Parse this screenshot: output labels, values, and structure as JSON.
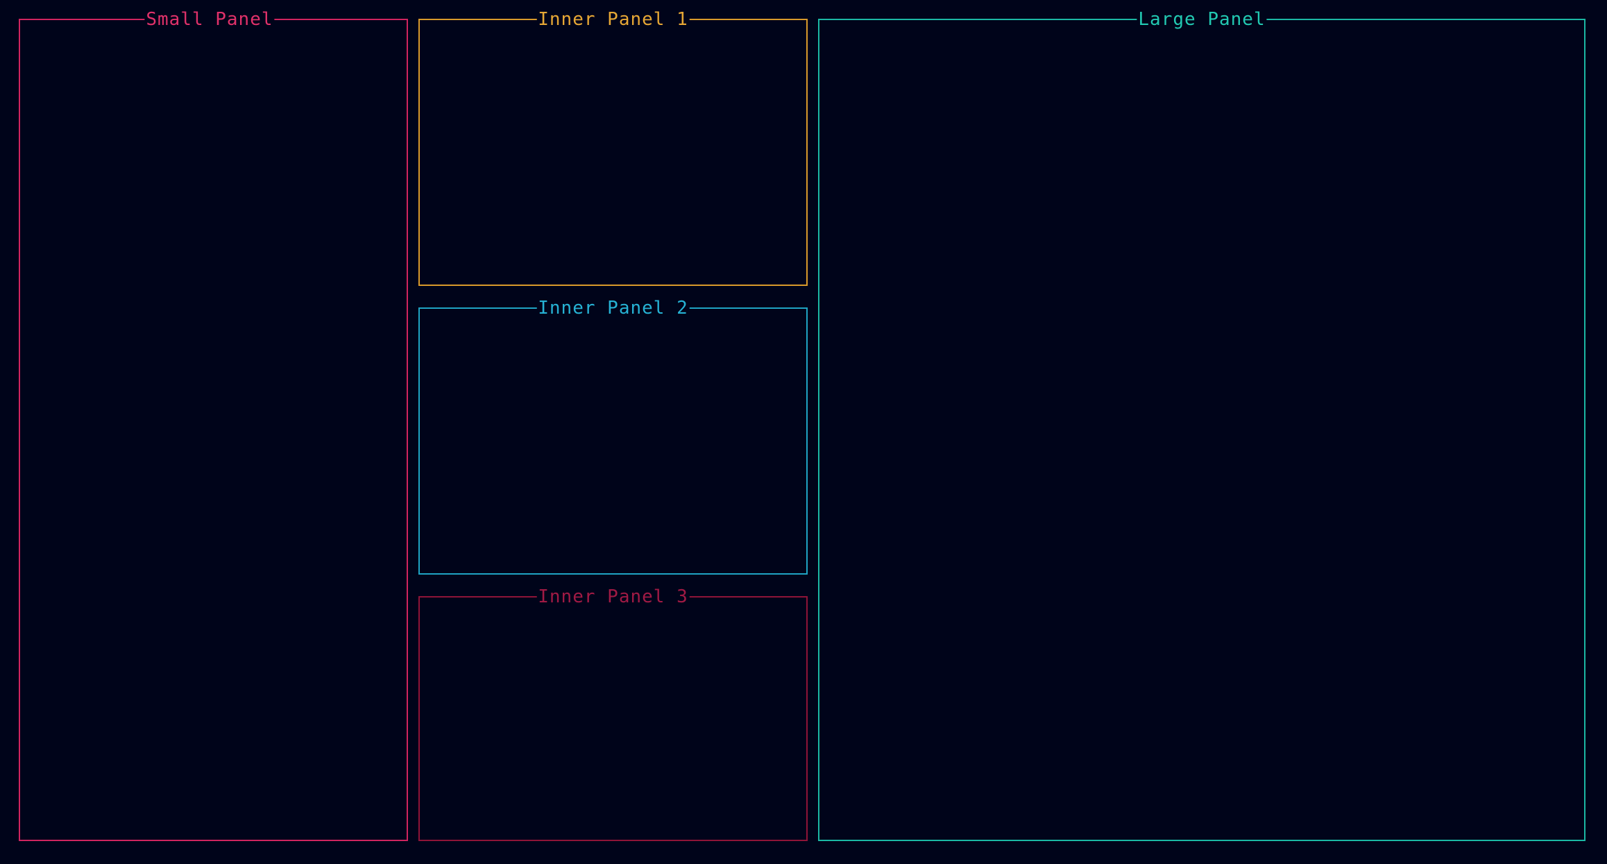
{
  "panels": {
    "small": {
      "title": "Small Panel",
      "color": "#d0245f"
    },
    "inner1": {
      "title": "Inner Panel 1",
      "color": "#d99a2b"
    },
    "inner2": {
      "title": "Inner Panel 2",
      "color": "#1fa4c4"
    },
    "inner3": {
      "title": "Inner Panel 3",
      "color": "#8f1438"
    },
    "large": {
      "title": "Large Panel",
      "color": "#1bb8a4"
    }
  },
  "theme": {
    "background": "#00041a"
  }
}
